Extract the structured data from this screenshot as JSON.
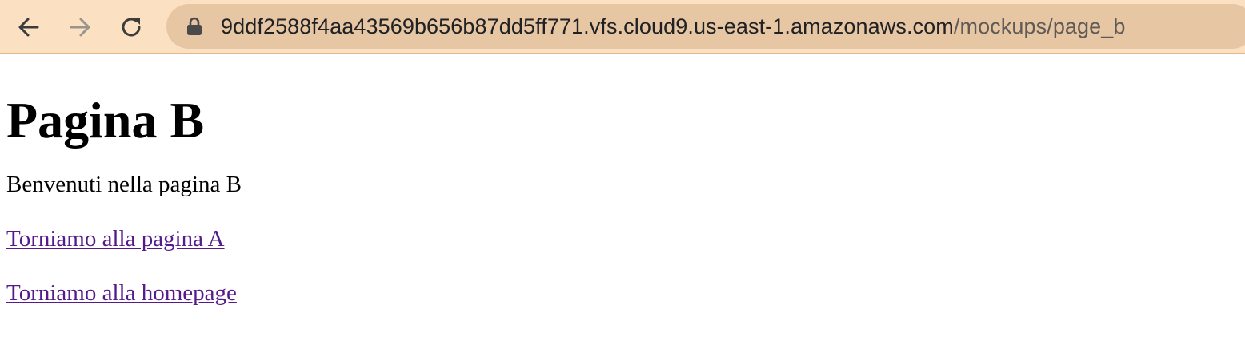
{
  "browser": {
    "url_host": "9ddf2588f4aa43569b656b87dd5ff771.vfs.cloud9.us-east-1.amazonaws.com",
    "url_path": "/mockups/page_b",
    "toolbar_color": "#fbe0c2",
    "omnibox_color": "#e6c6a3",
    "icons": {
      "back": "arrow-left-icon",
      "forward": "arrow-right-icon",
      "reload": "reload-icon",
      "lock": "lock-icon"
    }
  },
  "page": {
    "heading": "Pagina B",
    "welcome_text": "Benvenuti nella pagina B",
    "links": [
      {
        "label": "Torniamo alla pagina A"
      },
      {
        "label": "Torniamo alla homepage"
      }
    ],
    "link_color": "#551a8b"
  }
}
